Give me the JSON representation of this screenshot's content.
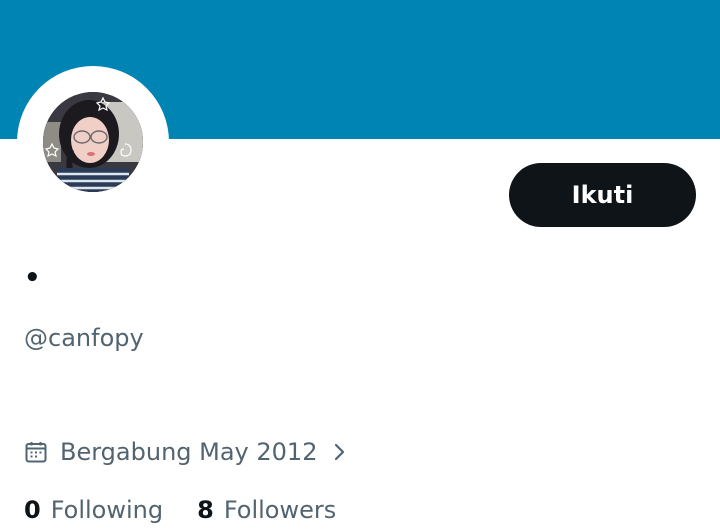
{
  "profile": {
    "display_name": "•",
    "handle": "@canfopy",
    "joined_text": "Bergabung May 2012",
    "follow_label": "Ikuti"
  },
  "stats": {
    "following_count": "0",
    "following_label": "Following",
    "followers_count": "8",
    "followers_label": "Followers"
  },
  "colors": {
    "banner": "#0084b4",
    "button_bg": "#0f1419",
    "secondary_text": "#536471"
  },
  "icons": {
    "joined": "calendar-icon",
    "joined_more": "chevron-right-icon"
  }
}
